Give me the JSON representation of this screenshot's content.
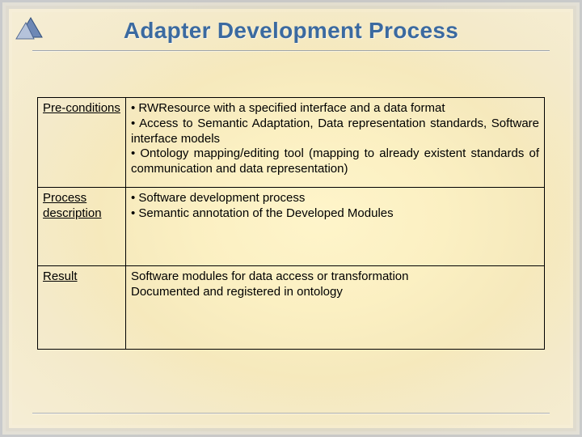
{
  "title": "Adapter Development Process",
  "rows": [
    {
      "label": "Pre-conditions",
      "body": "•  RWResource with a specified interface and a data format\n•   Access to Semantic Adaptation, Data representation standards, Software interface models\n•  Ontology mapping/editing tool (mapping to already existent standards of communication and data representation)"
    },
    {
      "label": "Process description",
      "body": "•  Software development process\n• Semantic annotation of the Developed Modules"
    },
    {
      "label": "Result",
      "body": "Software modules for data access or transformation\nDocumented and registered in ontology"
    }
  ]
}
